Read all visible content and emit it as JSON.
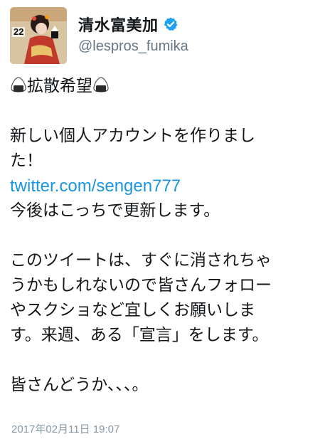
{
  "author": {
    "display_name": "清水富美加",
    "handle": "@lespros_fumika",
    "verified": true,
    "avatar_badge": "22"
  },
  "tweet": {
    "line1_text": "拡散希望",
    "line2": "新しい個人アカウントを作りまし",
    "line3": "た！",
    "link_text": "twitter.com/sengen777",
    "line5": "今後はこっちで更新します。",
    "line6": "このツイートは、すぐに消されちゃ",
    "line7": "うかもしれないので皆さんフォロー",
    "line8": "やスクショなど宜しくお願いしま",
    "line9": "す。来週、ある「宣言」をします。",
    "line10": "皆さんどうか、、、。"
  },
  "timestamp": "2017年02月11日 19:07",
  "colors": {
    "link": "#1b95e0",
    "verified": "#1da1f2",
    "secondary_text": "#657786"
  },
  "icons": {
    "verified": "verified-badge-icon",
    "onigiri": "rice-ball-icon"
  }
}
